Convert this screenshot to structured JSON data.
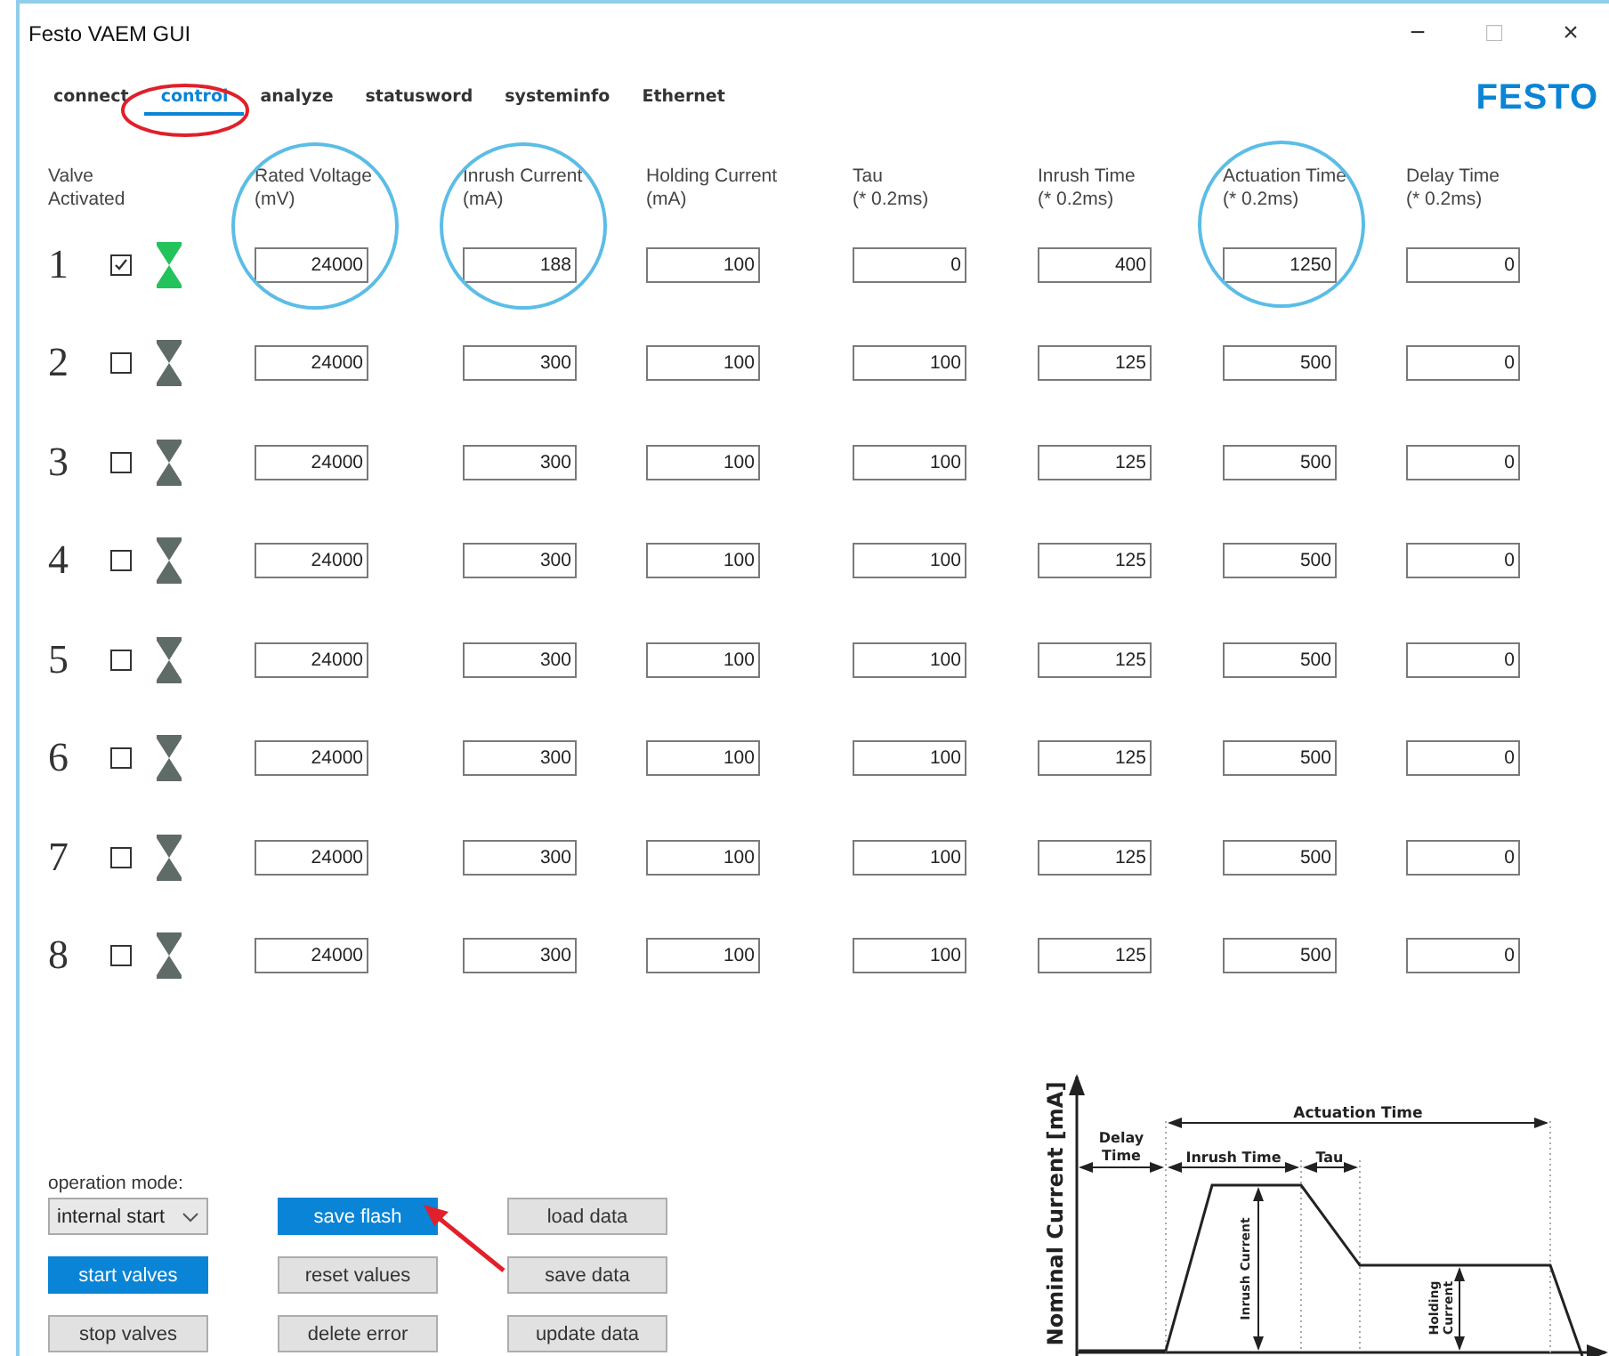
{
  "window": {
    "title": "Festo VAEM GUI",
    "controls": [
      "−",
      "□",
      "×"
    ]
  },
  "tabs": [
    {
      "label": "connect",
      "selected": false
    },
    {
      "label": "control",
      "selected": true
    },
    {
      "label": "analyze",
      "selected": false
    },
    {
      "label": "statusword",
      "selected": false
    },
    {
      "label": "systeminfo",
      "selected": false
    },
    {
      "label": "Ethernet",
      "selected": false
    }
  ],
  "logo": "FESTO",
  "table": {
    "valve_header": [
      "Valve",
      "Activated"
    ],
    "columns": [
      [
        "Rated Voltage",
        "(mV)"
      ],
      [
        "Inrush Current",
        "(mA)"
      ],
      [
        "Holding Current",
        "(mA)"
      ],
      [
        "Tau",
        "(* 0.2ms)"
      ],
      [
        "Inrush Time",
        "(* 0.2ms)"
      ],
      [
        "Actuation Time",
        "(* 0.2ms)"
      ],
      [
        "Delay Time",
        "(* 0.2ms)"
      ]
    ],
    "rows": [
      {
        "number": "1",
        "activated": true,
        "values": [
          "24000",
          "188",
          "100",
          "0",
          "400",
          "1250",
          "0"
        ]
      },
      {
        "number": "2",
        "activated": false,
        "values": [
          "24000",
          "300",
          "100",
          "100",
          "125",
          "500",
          "0"
        ]
      },
      {
        "number": "3",
        "activated": false,
        "values": [
          "24000",
          "300",
          "100",
          "100",
          "125",
          "500",
          "0"
        ]
      },
      {
        "number": "4",
        "activated": false,
        "values": [
          "24000",
          "300",
          "100",
          "100",
          "125",
          "500",
          "0"
        ]
      },
      {
        "number": "5",
        "activated": false,
        "values": [
          "24000",
          "300",
          "100",
          "100",
          "125",
          "500",
          "0"
        ]
      },
      {
        "number": "6",
        "activated": false,
        "values": [
          "24000",
          "300",
          "100",
          "100",
          "125",
          "500",
          "0"
        ]
      },
      {
        "number": "7",
        "activated": false,
        "values": [
          "24000",
          "300",
          "100",
          "100",
          "125",
          "500",
          "0"
        ]
      },
      {
        "number": "8",
        "activated": false,
        "values": [
          "24000",
          "300",
          "100",
          "100",
          "125",
          "500",
          "0"
        ]
      }
    ]
  },
  "operation_mode": {
    "label": "operation mode:",
    "value": "internal start"
  },
  "buttons": [
    {
      "label": "save flash",
      "kind": "primary"
    },
    {
      "label": "load data",
      "kind": "default"
    },
    {
      "label": "start valves",
      "kind": "primary"
    },
    {
      "label": "reset values",
      "kind": "default"
    },
    {
      "label": "save data",
      "kind": "default"
    },
    {
      "label": "stop valves",
      "kind": "default"
    },
    {
      "label": "delete error",
      "kind": "default"
    },
    {
      "label": "update data",
      "kind": "default"
    }
  ],
  "diagram": {
    "ylabel": "Nominal Current [mA]",
    "actuation_time": "Actuation Time",
    "delay_time": [
      "Delay",
      "Time"
    ],
    "inrush_time": "Inrush Time",
    "tau": "Tau",
    "inrush_current": "Inrush Current",
    "holding_current": [
      "Holding",
      "Current"
    ]
  }
}
